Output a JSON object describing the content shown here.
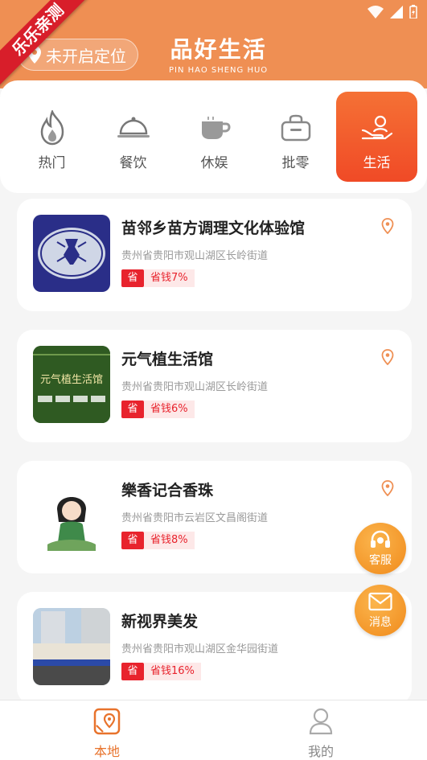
{
  "ribbon": "乐乐亲测",
  "header": {
    "location_label": "未开启定位",
    "brand_title": "品好生活",
    "brand_subtitle": "PIN HAO SHENG HUO"
  },
  "categories": [
    {
      "label": "热门",
      "icon": "fire-icon",
      "active": false
    },
    {
      "label": "餐饮",
      "icon": "dining-cloche-icon",
      "active": false
    },
    {
      "label": "休娱",
      "icon": "coffee-cup-icon",
      "active": false
    },
    {
      "label": "批零",
      "icon": "shopping-bag-icon",
      "active": false
    },
    {
      "label": "生活",
      "icon": "hand-person-icon",
      "active": true
    }
  ],
  "stores": [
    {
      "name": "苗邻乡苗方调理文化体验馆",
      "address": "贵州省贵阳市观山湖区长岭街道",
      "tag": "省",
      "saving": "省钱7%"
    },
    {
      "name": "元气植生活馆",
      "address": "贵州省贵阳市观山湖区长岭街道",
      "tag": "省",
      "saving": "省钱6%"
    },
    {
      "name": "樂香记合香珠",
      "address": "贵州省贵阳市云岩区文昌阁街道",
      "tag": "省",
      "saving": "省钱8%"
    },
    {
      "name": "新视界美发",
      "address": "贵州省贵阳市观山湖区金华园街道",
      "tag": "省",
      "saving": "省钱16%"
    }
  ],
  "floating": {
    "service": "客服",
    "message": "消息"
  },
  "bottom_nav": {
    "local": "本地",
    "mine": "我的"
  },
  "colors": {
    "header": "#ef8f53",
    "accent": "#f04a26",
    "red": "#e8232d",
    "float": "#f08a1b"
  }
}
